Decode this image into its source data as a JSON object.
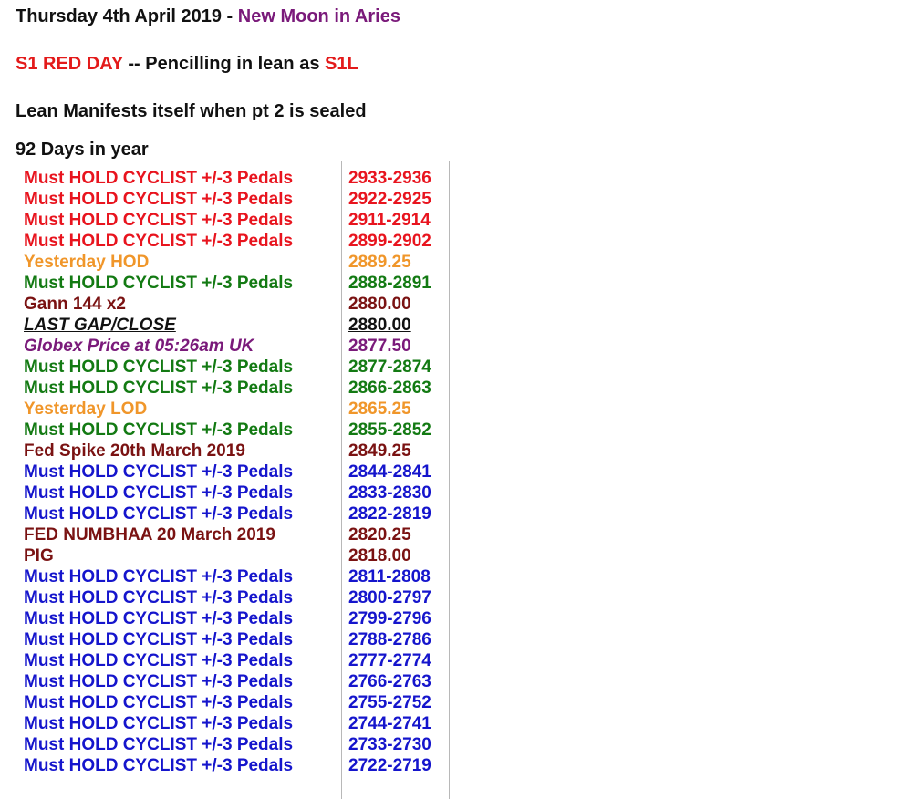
{
  "header": {
    "date": "Thursday 4th April 2019",
    "sep": " - ",
    "event": "New Moon in Aries",
    "red_day": "S1 RED DAY",
    "pencil_text": " -- Pencilling in lean as ",
    "lean": "S1L",
    "lean_line": "Lean Manifests itself when pt 2 is sealed",
    "days_line": "92 Days in year"
  },
  "colors": {
    "red": "#e8141e",
    "orange": "#f0962a",
    "green": "#137a13",
    "maroon": "#7a1212",
    "purple": "#7a1a7a",
    "black": "#111111",
    "blue": "#1515cc"
  },
  "rows": [
    {
      "label": "Must HOLD CYCLIST +/-3 Pedals",
      "value": "2933-2936",
      "style": "red"
    },
    {
      "label": "Must HOLD CYCLIST +/-3 Pedals",
      "value": "2922-2925",
      "style": "red"
    },
    {
      "label": "Must HOLD CYCLIST +/-3 Pedals",
      "value": "2911-2914",
      "style": "red"
    },
    {
      "label": "Must HOLD CYCLIST +/-3 Pedals",
      "value": "2899-2902",
      "style": "red"
    },
    {
      "label": "Yesterday HOD",
      "value": "2889.25",
      "style": "orange"
    },
    {
      "label": "Must HOLD CYCLIST +/-3 Pedals",
      "value": "2888-2891",
      "style": "green"
    },
    {
      "label": "Gann 144 x2",
      "value": "2880.00",
      "style": "maroon"
    },
    {
      "label": "LAST GAP/CLOSE",
      "value": "2880.00",
      "style": "black"
    },
    {
      "label": "Globex Price at 05:26am UK",
      "value": "2877.50",
      "style": "purple"
    },
    {
      "label": "Must HOLD CYCLIST +/-3 Pedals",
      "value": "2877-2874",
      "style": "green"
    },
    {
      "label": "Must HOLD CYCLIST +/-3 Pedals",
      "value": "2866-2863",
      "style": "green"
    },
    {
      "label": "Yesterday LOD",
      "value": "2865.25",
      "style": "orange"
    },
    {
      "label": "Must HOLD CYCLIST +/-3 Pedals",
      "value": "2855-2852",
      "style": "green"
    },
    {
      "label": "Fed Spike 20th March 2019",
      "value": "2849.25",
      "style": "maroon"
    },
    {
      "label": "Must HOLD CYCLIST +/-3 Pedals",
      "value": "2844-2841",
      "style": "blue"
    },
    {
      "label": "Must HOLD CYCLIST +/-3 Pedals",
      "value": "2833-2830",
      "style": "blue"
    },
    {
      "label": "Must HOLD CYCLIST +/-3 Pedals",
      "value": "2822-2819",
      "style": "blue"
    },
    {
      "label": "FED NUMBHAA 20 March 2019",
      "value": "2820.25",
      "style": "maroon"
    },
    {
      "label": "PIG",
      "value": "2818.00",
      "style": "maroon"
    },
    {
      "label": "Must HOLD CYCLIST +/-3 Pedals",
      "value": "2811-2808",
      "style": "blue"
    },
    {
      "label": "Must HOLD CYCLIST +/-3 Pedals",
      "value": "2800-2797",
      "style": "blue"
    },
    {
      "label": "Must HOLD CYCLIST +/-3 Pedals",
      "value": "2799-2796",
      "style": "blue"
    },
    {
      "label": "Must HOLD CYCLIST +/-3 Pedals",
      "value": "2788-2786",
      "style": "blue"
    },
    {
      "label": "Must HOLD CYCLIST +/-3 Pedals",
      "value": "2777-2774",
      "style": "blue"
    },
    {
      "label": "Must HOLD CYCLIST +/-3 Pedals",
      "value": "2766-2763",
      "style": "blue"
    },
    {
      "label": "Must HOLD CYCLIST +/-3 Pedals",
      "value": "2755-2752",
      "style": "blue"
    },
    {
      "label": "Must HOLD CYCLIST +/-3 Pedals",
      "value": "2744-2741",
      "style": "blue"
    },
    {
      "label": "Must HOLD CYCLIST +/-3 Pedals",
      "value": "2733-2730",
      "style": "blue"
    },
    {
      "label": "Must HOLD CYCLIST +/-3 Pedals",
      "value": "2722-2719",
      "style": "blue"
    }
  ]
}
